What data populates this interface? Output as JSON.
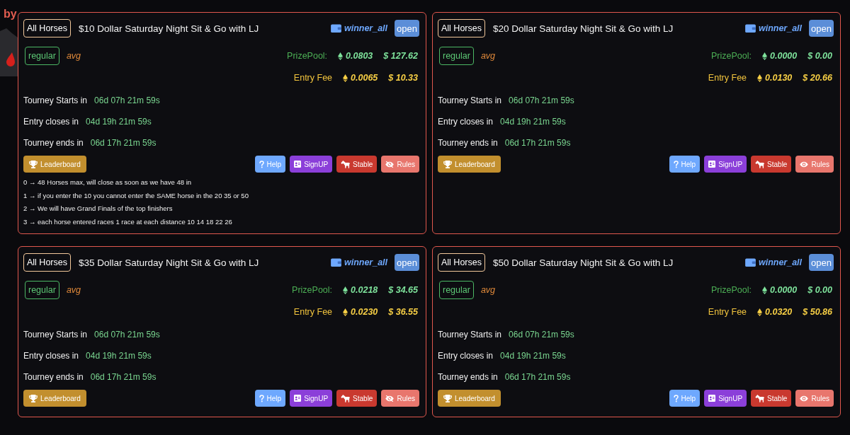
{
  "branding": {
    "byline": "by"
  },
  "tourneys": [
    {
      "category": "All Horses",
      "title": "$10 Dollar Saturday Night Sit & Go with LJ",
      "payout": "winner_all",
      "status": "open",
      "class": "regular",
      "rating": "avg",
      "prize_pool": {
        "label": "PrizePool:",
        "eth": "0.0803",
        "usd": "$ 127.62"
      },
      "entry_fee": {
        "label": "Entry Fee",
        "eth": "0.0065",
        "usd": "$ 10.33"
      },
      "timers": [
        {
          "label": "Tourney Starts in",
          "value": "06d 07h 21m 59s"
        },
        {
          "label": "Entry closes in",
          "value": "04d 19h 21m 59s"
        },
        {
          "label": "Tourney ends in",
          "value": "06d 17h 21m 59s"
        }
      ],
      "buttons": [
        {
          "kind": "leaderboard",
          "label": "Leaderboard"
        },
        {
          "kind": "help",
          "label": "Help"
        },
        {
          "kind": "signup",
          "label": "SignUP"
        },
        {
          "kind": "stable",
          "label": "Stable"
        },
        {
          "kind": "rules",
          "label": "Rules",
          "crossed": true
        }
      ],
      "notes": [
        "0 → 48 Horses max, will close as soon as we have 48 in",
        "1 → if you enter the 10 you cannot enter the SAME horse in the 20 35 or 50",
        "2 → We will have Grand Finals of the top finishers",
        "3 → each horse entered races 1 race at each distance 10 14 18 22 26"
      ]
    },
    {
      "category": "All Horses",
      "title": "$20 Dollar Saturday Night Sit & Go with LJ",
      "payout": "winner_all",
      "status": "open",
      "class": "regular",
      "rating": "avg",
      "prize_pool": {
        "label": "PrizePool:",
        "eth": "0.0000",
        "usd": "$ 0.00"
      },
      "entry_fee": {
        "label": "Entry Fee",
        "eth": "0.0130",
        "usd": "$ 20.66"
      },
      "timers": [
        {
          "label": "Tourney Starts in",
          "value": "06d 07h 21m 59s"
        },
        {
          "label": "Entry closes in",
          "value": "04d 19h 21m 59s"
        },
        {
          "label": "Tourney ends in",
          "value": "06d 17h 21m 59s"
        }
      ],
      "buttons": [
        {
          "kind": "leaderboard",
          "label": "Leaderboard"
        },
        {
          "kind": "help",
          "label": "Help"
        },
        {
          "kind": "signup",
          "label": "SignUP"
        },
        {
          "kind": "stable",
          "label": "Stable"
        },
        {
          "kind": "rules",
          "label": "Rules",
          "crossed": false
        }
      ]
    },
    {
      "category": "All Horses",
      "title": "$35 Dollar Saturday Night Sit & Go with LJ",
      "payout": "winner_all",
      "status": "open",
      "class": "regular",
      "rating": "avg",
      "prize_pool": {
        "label": "PrizePool:",
        "eth": "0.0218",
        "usd": "$ 34.65"
      },
      "entry_fee": {
        "label": "Entry Fee",
        "eth": "0.0230",
        "usd": "$ 36.55"
      },
      "timers": [
        {
          "label": "Tourney Starts in",
          "value": "06d 07h 21m 59s"
        },
        {
          "label": "Entry closes in",
          "value": "04d 19h 21m 59s"
        },
        {
          "label": "Tourney ends in",
          "value": "06d 17h 21m 59s"
        }
      ],
      "buttons": [
        {
          "kind": "leaderboard",
          "label": "Leaderboard"
        },
        {
          "kind": "help",
          "label": "Help"
        },
        {
          "kind": "signup",
          "label": "SignUP"
        },
        {
          "kind": "stable",
          "label": "Stable"
        },
        {
          "kind": "rules",
          "label": "Rules",
          "crossed": true
        }
      ]
    },
    {
      "category": "All Horses",
      "title": "$50 Dollar Saturday Night Sit & Go with LJ",
      "payout": "winner_all",
      "status": "open",
      "class": "regular",
      "rating": "avg",
      "prize_pool": {
        "label": "PrizePool:",
        "eth": "0.0000",
        "usd": "$ 0.00"
      },
      "entry_fee": {
        "label": "Entry Fee",
        "eth": "0.0320",
        "usd": "$ 50.86"
      },
      "timers": [
        {
          "label": "Tourney Starts in",
          "value": "06d 07h 21m 59s"
        },
        {
          "label": "Entry closes in",
          "value": "04d 19h 21m 59s"
        },
        {
          "label": "Tourney ends in",
          "value": "06d 17h 21m 59s"
        }
      ],
      "buttons": [
        {
          "kind": "leaderboard",
          "label": "Leaderboard"
        },
        {
          "kind": "help",
          "label": "Help"
        },
        {
          "kind": "signup",
          "label": "SignUP"
        },
        {
          "kind": "stable",
          "label": "Stable"
        },
        {
          "kind": "rules",
          "label": "Rules",
          "crossed": false
        }
      ]
    }
  ]
}
